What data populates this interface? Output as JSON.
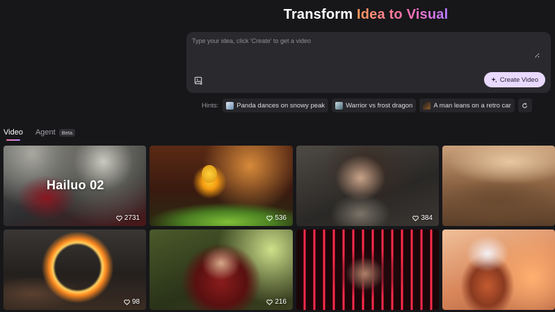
{
  "header": {
    "title_part1": "Transform ",
    "title_part2": "Idea to Visual"
  },
  "prompt": {
    "placeholder": "Type your idea, click 'Create' to get a video",
    "value": "",
    "upload_icon": "image-upload-icon",
    "create_button_icon": "sparkle-icon",
    "create_button_label": "Create Video"
  },
  "hints": {
    "label": "Hints:",
    "items": [
      {
        "label": "Panda dances on snowy peak",
        "thumb_color": "#9ab8d8"
      },
      {
        "label": "Warrior vs frost dragon",
        "thumb_color": "#8aa8b8"
      },
      {
        "label": "A man leans on a retro car",
        "thumb_color": "#6a4a2a"
      }
    ],
    "refresh_icon": "refresh-icon"
  },
  "tabs": {
    "video": "Video",
    "agent": "Agent",
    "agent_badge": "Beta",
    "active": "video"
  },
  "gallery": {
    "like_icon": "heart-icon",
    "cards": [
      {
        "overlay_title": "Hailuo 02",
        "likes": "2731"
      },
      {
        "likes": "536"
      },
      {
        "likes": "384"
      },
      {
        "likes": ""
      },
      {
        "likes": "98"
      },
      {
        "likes": "216"
      },
      {
        "likes": ""
      },
      {
        "likes": ""
      }
    ]
  },
  "colors": {
    "background": "#17171a",
    "accent_gradient_start": "#ff9a5a",
    "accent_gradient_end": "#b97cff",
    "create_button_bg": "#e9d9ff"
  }
}
